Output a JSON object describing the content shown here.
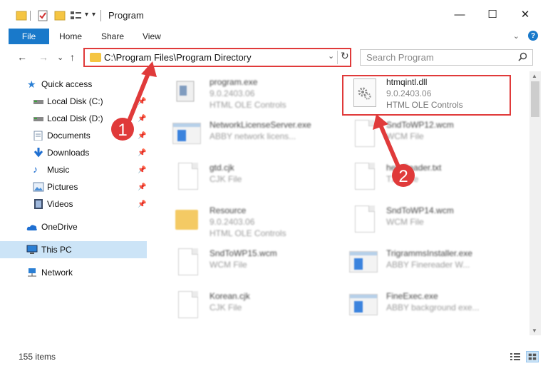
{
  "window": {
    "title": "Program",
    "minimize": "—",
    "maximize": "☐",
    "close": "✕"
  },
  "ribbon": {
    "file": "File",
    "tabs": [
      "Home",
      "Share",
      "View"
    ],
    "collapse_glyph": "⌄",
    "help_glyph": "?"
  },
  "address": {
    "back": "←",
    "forward": "→",
    "recent": "⌄",
    "up": "↑",
    "path": "C:\\Program Files\\Program Directory",
    "dropdown": "⌄",
    "refresh": "↻"
  },
  "search": {
    "placeholder": "Search Program",
    "icon": "search-icon"
  },
  "nav": {
    "quick_access": "Quick access",
    "items": [
      {
        "label": "Local Disk (C:)",
        "icon": "drive-icon",
        "pinned": true
      },
      {
        "label": "Local Disk (D:)",
        "icon": "drive-icon",
        "pinned": true
      },
      {
        "label": "Documents",
        "icon": "documents-icon",
        "pinned": true
      },
      {
        "label": "Downloads",
        "icon": "downloads-icon",
        "pinned": true
      },
      {
        "label": "Music",
        "icon": "music-icon",
        "pinned": true
      },
      {
        "label": "Pictures",
        "icon": "pictures-icon",
        "pinned": true
      },
      {
        "label": "Videos",
        "icon": "videos-icon",
        "pinned": true
      }
    ],
    "onedrive": "OneDrive",
    "this_pc": "This PC",
    "network": "Network"
  },
  "files": [
    {
      "name": "program.exe",
      "line1": "9.0.2403.06",
      "line2": "HTML OLE Controls",
      "icon": "program-icon"
    },
    {
      "name": "htmqintl.dll",
      "line1": "9.0.2403.06",
      "line2": "HTML OLE Controls",
      "icon": "dll-gear-icon"
    },
    {
      "name": "NetworkLicenseServer.exe",
      "line1": "ABBY network licens...",
      "line2": "",
      "icon": "app-icon"
    },
    {
      "name": "SndToWP12.wcm",
      "line1": "WCM File",
      "line2": "",
      "icon": "document-icon"
    },
    {
      "name": "gtd.cjk",
      "line1": "CJK File",
      "line2": "",
      "icon": "document-icon"
    },
    {
      "name": "helpReader.txt",
      "line1": "TXT File",
      "line2": "",
      "icon": "document-icon"
    },
    {
      "name": "Resource",
      "line1": "9.0.2403.06",
      "line2": "HTML OLE Controls",
      "icon": "folder-icon"
    },
    {
      "name": "SndToWP14.wcm",
      "line1": "WCM File",
      "line2": "",
      "icon": "document-icon"
    },
    {
      "name": "SndToWP15.wcm",
      "line1": "WCM File",
      "line2": "",
      "icon": "document-icon"
    },
    {
      "name": "TrigrammsInstaller.exe",
      "line1": "ABBY Finereader W...",
      "line2": "",
      "icon": "app-icon"
    },
    {
      "name": "Korean.cjk",
      "line1": "CJK File",
      "line2": "",
      "icon": "document-icon"
    },
    {
      "name": "FineExec.exe",
      "line1": "ABBY background exe...",
      "line2": "",
      "icon": "app-icon"
    }
  ],
  "status": {
    "items": "155 items"
  },
  "annotations": {
    "step1": "1",
    "step2": "2"
  },
  "colors": {
    "accent": "#1979ca",
    "highlight": "#e03a3a",
    "selection": "#cce4f7"
  }
}
